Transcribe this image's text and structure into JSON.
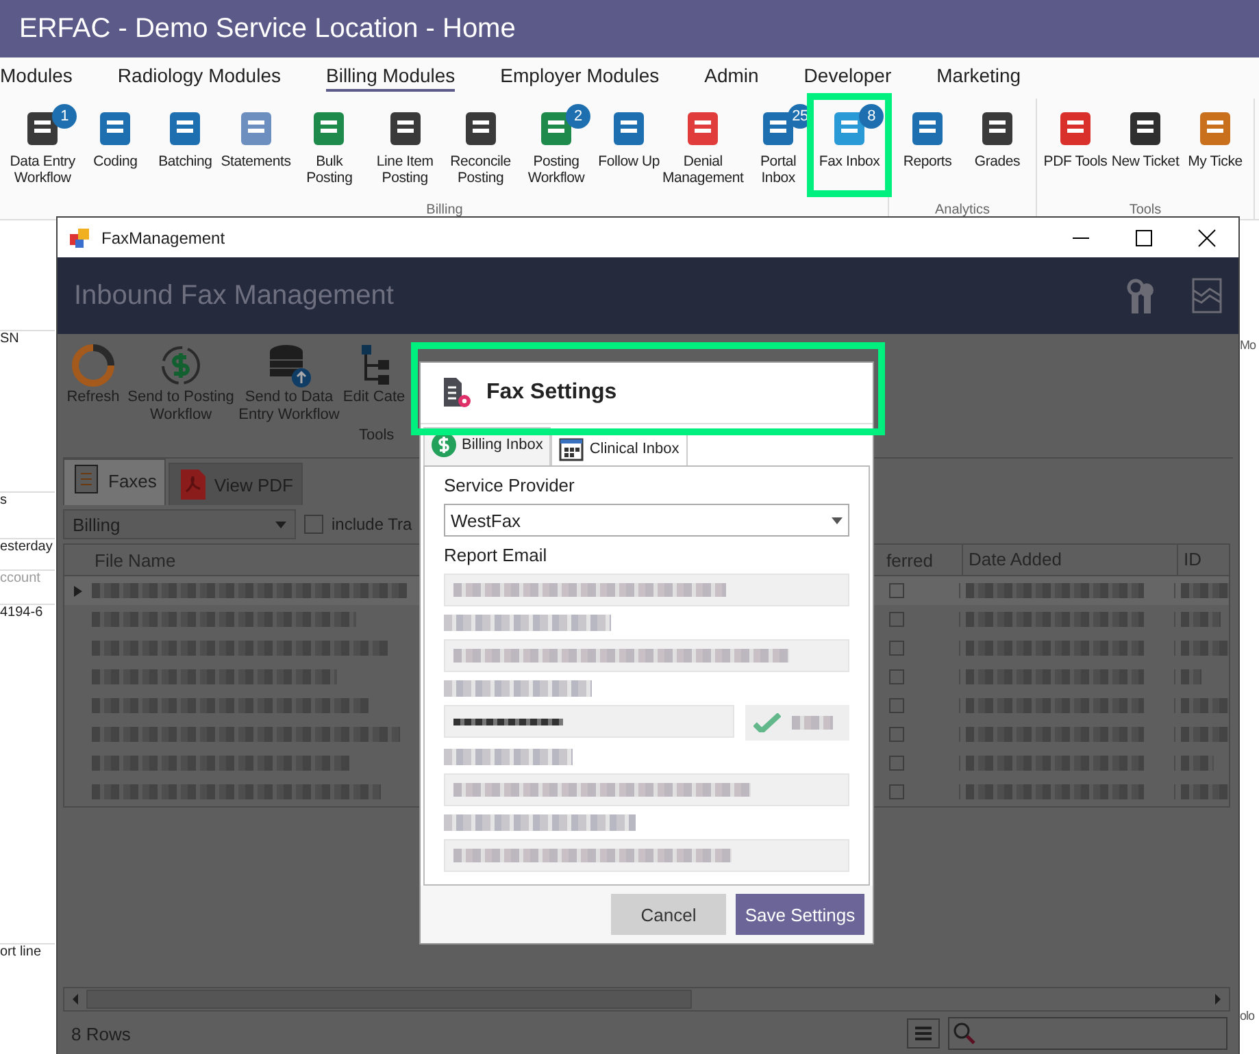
{
  "app": {
    "title": "ERFAC - Demo Service Location - Home",
    "menu": [
      {
        "label": "Modules",
        "selected": false
      },
      {
        "label": "Radiology Modules",
        "selected": false
      },
      {
        "label": "Billing Modules",
        "selected": true
      },
      {
        "label": "Employer Modules",
        "selected": false
      },
      {
        "label": "Admin",
        "selected": false
      },
      {
        "label": "Developer",
        "selected": false
      },
      {
        "label": "Marketing",
        "selected": false
      }
    ],
    "ribbon_groups": [
      {
        "label": "Billing",
        "buttons": [
          {
            "label": "Data Entry Workflow",
            "badge": "1"
          },
          {
            "label": "Coding"
          },
          {
            "label": "Batching"
          },
          {
            "label": "Statements"
          },
          {
            "label": "Bulk Posting"
          },
          {
            "label": "Line Item Posting"
          },
          {
            "label": "Reconcile Posting"
          },
          {
            "label": "Posting Workflow",
            "badge": "2"
          },
          {
            "label": "Follow Up"
          },
          {
            "label": "Denial Management"
          },
          {
            "label": "Portal Inbox",
            "badge": "25"
          },
          {
            "label": "Fax Inbox",
            "badge": "8"
          }
        ]
      },
      {
        "label": "Analytics",
        "buttons": [
          {
            "label": "Reports"
          },
          {
            "label": "Grades"
          }
        ]
      },
      {
        "label": "Tools",
        "buttons": [
          {
            "label": "PDF Tools"
          },
          {
            "label": "New Ticket"
          },
          {
            "label": "My Ticke"
          }
        ]
      }
    ],
    "left_texts": [
      "SN",
      "s",
      "esterday",
      "ccount",
      "4194-6",
      "ort line"
    ],
    "right_texts": [
      "Mo",
      "olo"
    ]
  },
  "fax_window": {
    "title": "FaxManagement",
    "header": "Inbound Fax Management",
    "tools": [
      "Refresh",
      "Send to Posting Workflow",
      "Send to Data Entry Workflow",
      "Edit Cate"
    ],
    "tools_group": "Tools",
    "tabs": [
      {
        "label": "Faxes",
        "selected": true
      },
      {
        "label": "View PDF",
        "selected": false
      }
    ],
    "filter": {
      "value": "Billing",
      "checkbox_label": "include Tra",
      "checked": false
    },
    "columns": {
      "left": [
        "File Name"
      ],
      "right": [
        "ferred",
        "Date Added",
        "ID"
      ]
    },
    "rows": [
      {
        "selected": true,
        "checked": false
      },
      {
        "selected": false,
        "checked": false
      },
      {
        "selected": false,
        "checked": false
      },
      {
        "selected": false,
        "checked": false
      },
      {
        "selected": false,
        "checked": false
      },
      {
        "selected": false,
        "checked": false
      },
      {
        "selected": false,
        "checked": false
      },
      {
        "selected": false,
        "checked": false
      }
    ],
    "status": "8 Rows"
  },
  "dialog": {
    "title": "Fax Settings",
    "tabs": [
      {
        "label": "Billing Inbox",
        "selected": true
      },
      {
        "label": "Clinical Inbox",
        "selected": false
      }
    ],
    "fields": [
      {
        "kind": "label",
        "text": "Service Provider"
      },
      {
        "kind": "select",
        "value": "WestFax"
      },
      {
        "kind": "label",
        "text": "Report Email"
      },
      {
        "kind": "blurred-field"
      },
      {
        "kind": "blurred-label"
      },
      {
        "kind": "blurred-field"
      },
      {
        "kind": "blurred-label"
      },
      {
        "kind": "blurred-password"
      },
      {
        "kind": "blurred-label"
      },
      {
        "kind": "blurred-field"
      },
      {
        "kind": "blurred-label"
      },
      {
        "kind": "blurred-field"
      }
    ],
    "buttons": [
      {
        "label": "Cancel",
        "kind": "secondary"
      },
      {
        "label": "Save Settings",
        "kind": "primary"
      }
    ]
  }
}
